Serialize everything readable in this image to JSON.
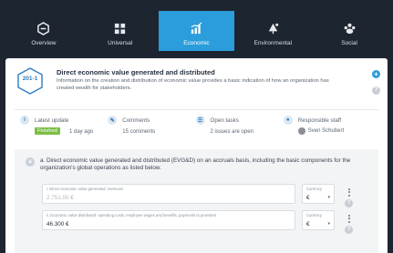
{
  "nav": {
    "tabs": [
      {
        "label": "Overview",
        "icon": "overview-icon"
      },
      {
        "label": "Universal",
        "icon": "universal-icon"
      },
      {
        "label": "Economic",
        "icon": "economic-icon",
        "active": true
      },
      {
        "label": "Environmental",
        "icon": "environmental-icon"
      },
      {
        "label": "Social",
        "icon": "social-icon"
      }
    ]
  },
  "disclosure": {
    "code": "201-1",
    "title": "Direct economic value generated and distributed",
    "description": "Information on the creation and distribution of economic value provides a basic indication of how an organization has created wealth for stakeholders."
  },
  "info": {
    "latest_update": {
      "label": "Latest update",
      "badge": "Finished",
      "value": "1 day ago"
    },
    "comments": {
      "label": "Comments",
      "value": "15 comments"
    },
    "open_tasks": {
      "label": "Open tasks",
      "value": "2 issues are open"
    },
    "staff": {
      "label": "Responsible staff",
      "value": "Sven Schubert"
    }
  },
  "question": {
    "letter": "a",
    "text": "a. Direct economic value generated and distributed (EVG&D) on an accruals basis, including the basic components for the organization's global operations as listed below.",
    "fields": [
      {
        "label": "i. Direct economic value generated: revenues",
        "value": "2.751,00 €",
        "currency_label": "Currency",
        "currency": "€"
      },
      {
        "label": "ii. Economic value distributed: operating costs, employee wages and benefits, payments to providers",
        "value": "46.300 €",
        "currency_label": "Currency",
        "currency": "€"
      }
    ]
  },
  "colors": {
    "accent": "#2b9ddc",
    "nav_bg": "#1d2630",
    "badge": "#7bbf44"
  }
}
